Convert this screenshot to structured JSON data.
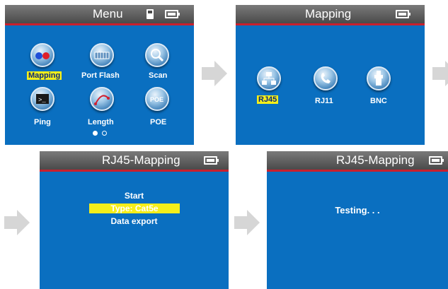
{
  "screens": {
    "menu": {
      "title": "Menu",
      "items": [
        {
          "label": "Mapping",
          "icon": "mapping-icon",
          "selected": true
        },
        {
          "label": "Port Flash",
          "icon": "port-flash-icon",
          "selected": false
        },
        {
          "label": "Scan",
          "icon": "magnifier-icon",
          "selected": false
        },
        {
          "label": "Ping",
          "icon": "terminal-icon",
          "selected": false
        },
        {
          "label": "Length",
          "icon": "length-icon",
          "selected": false
        },
        {
          "label": "POE",
          "icon": "poe-icon",
          "selected": false
        }
      ],
      "page_indicator": {
        "pages": 2,
        "current": 1
      }
    },
    "mapping": {
      "title": "Mapping",
      "items": [
        {
          "label": "RJ45",
          "icon": "rj45-network-icon",
          "selected": true
        },
        {
          "label": "RJ11",
          "icon": "phone-icon",
          "selected": false
        },
        {
          "label": "BNC",
          "icon": "bnc-connector-icon",
          "selected": false
        }
      ]
    },
    "rj45_menu": {
      "title": "RJ45-Mapping",
      "items": [
        {
          "label": "Start",
          "selected": false
        },
        {
          "label": "Type: Cat5e",
          "selected": true
        },
        {
          "label": "Data export",
          "selected": false
        }
      ]
    },
    "rj45_testing": {
      "title": "RJ45-Mapping",
      "status": "Testing. . ."
    }
  },
  "colors": {
    "screen_bg": "#0a6fc0",
    "header_bg": "#5a5a5a",
    "header_accent": "#c8202e",
    "highlight": "#f4ee1a",
    "arrow": "#d6d6d6"
  }
}
